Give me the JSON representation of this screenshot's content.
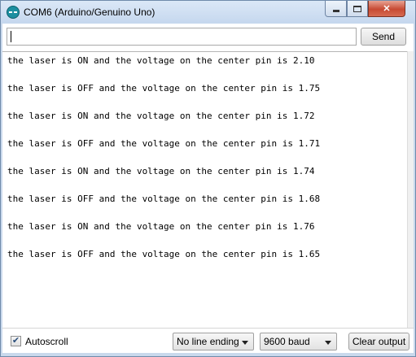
{
  "window": {
    "title": "COM6 (Arduino/Genuino Uno)",
    "close_glyph": "✕"
  },
  "input": {
    "value": "",
    "send_label": "Send"
  },
  "output": {
    "lines": [
      "the laser is ON and the voltage on the center pin is 2.10",
      "the laser is OFF and the voltage on the center pin is 1.75",
      "the laser is ON and the voltage on the center pin is 1.72",
      "the laser is OFF and the voltage on the center pin is 1.71",
      "the laser is ON and the voltage on the center pin is 1.74",
      "the laser is OFF and the voltage on the center pin is 1.68",
      "the laser is ON and the voltage on the center pin is 1.76",
      "the laser is OFF and the voltage on the center pin is 1.65"
    ]
  },
  "footer": {
    "autoscroll_label": "Autoscroll",
    "autoscroll_checked": true,
    "autoscroll_mark": "✔",
    "line_ending": "No line ending",
    "baud_rate": "9600 baud",
    "clear_label": "Clear output"
  }
}
